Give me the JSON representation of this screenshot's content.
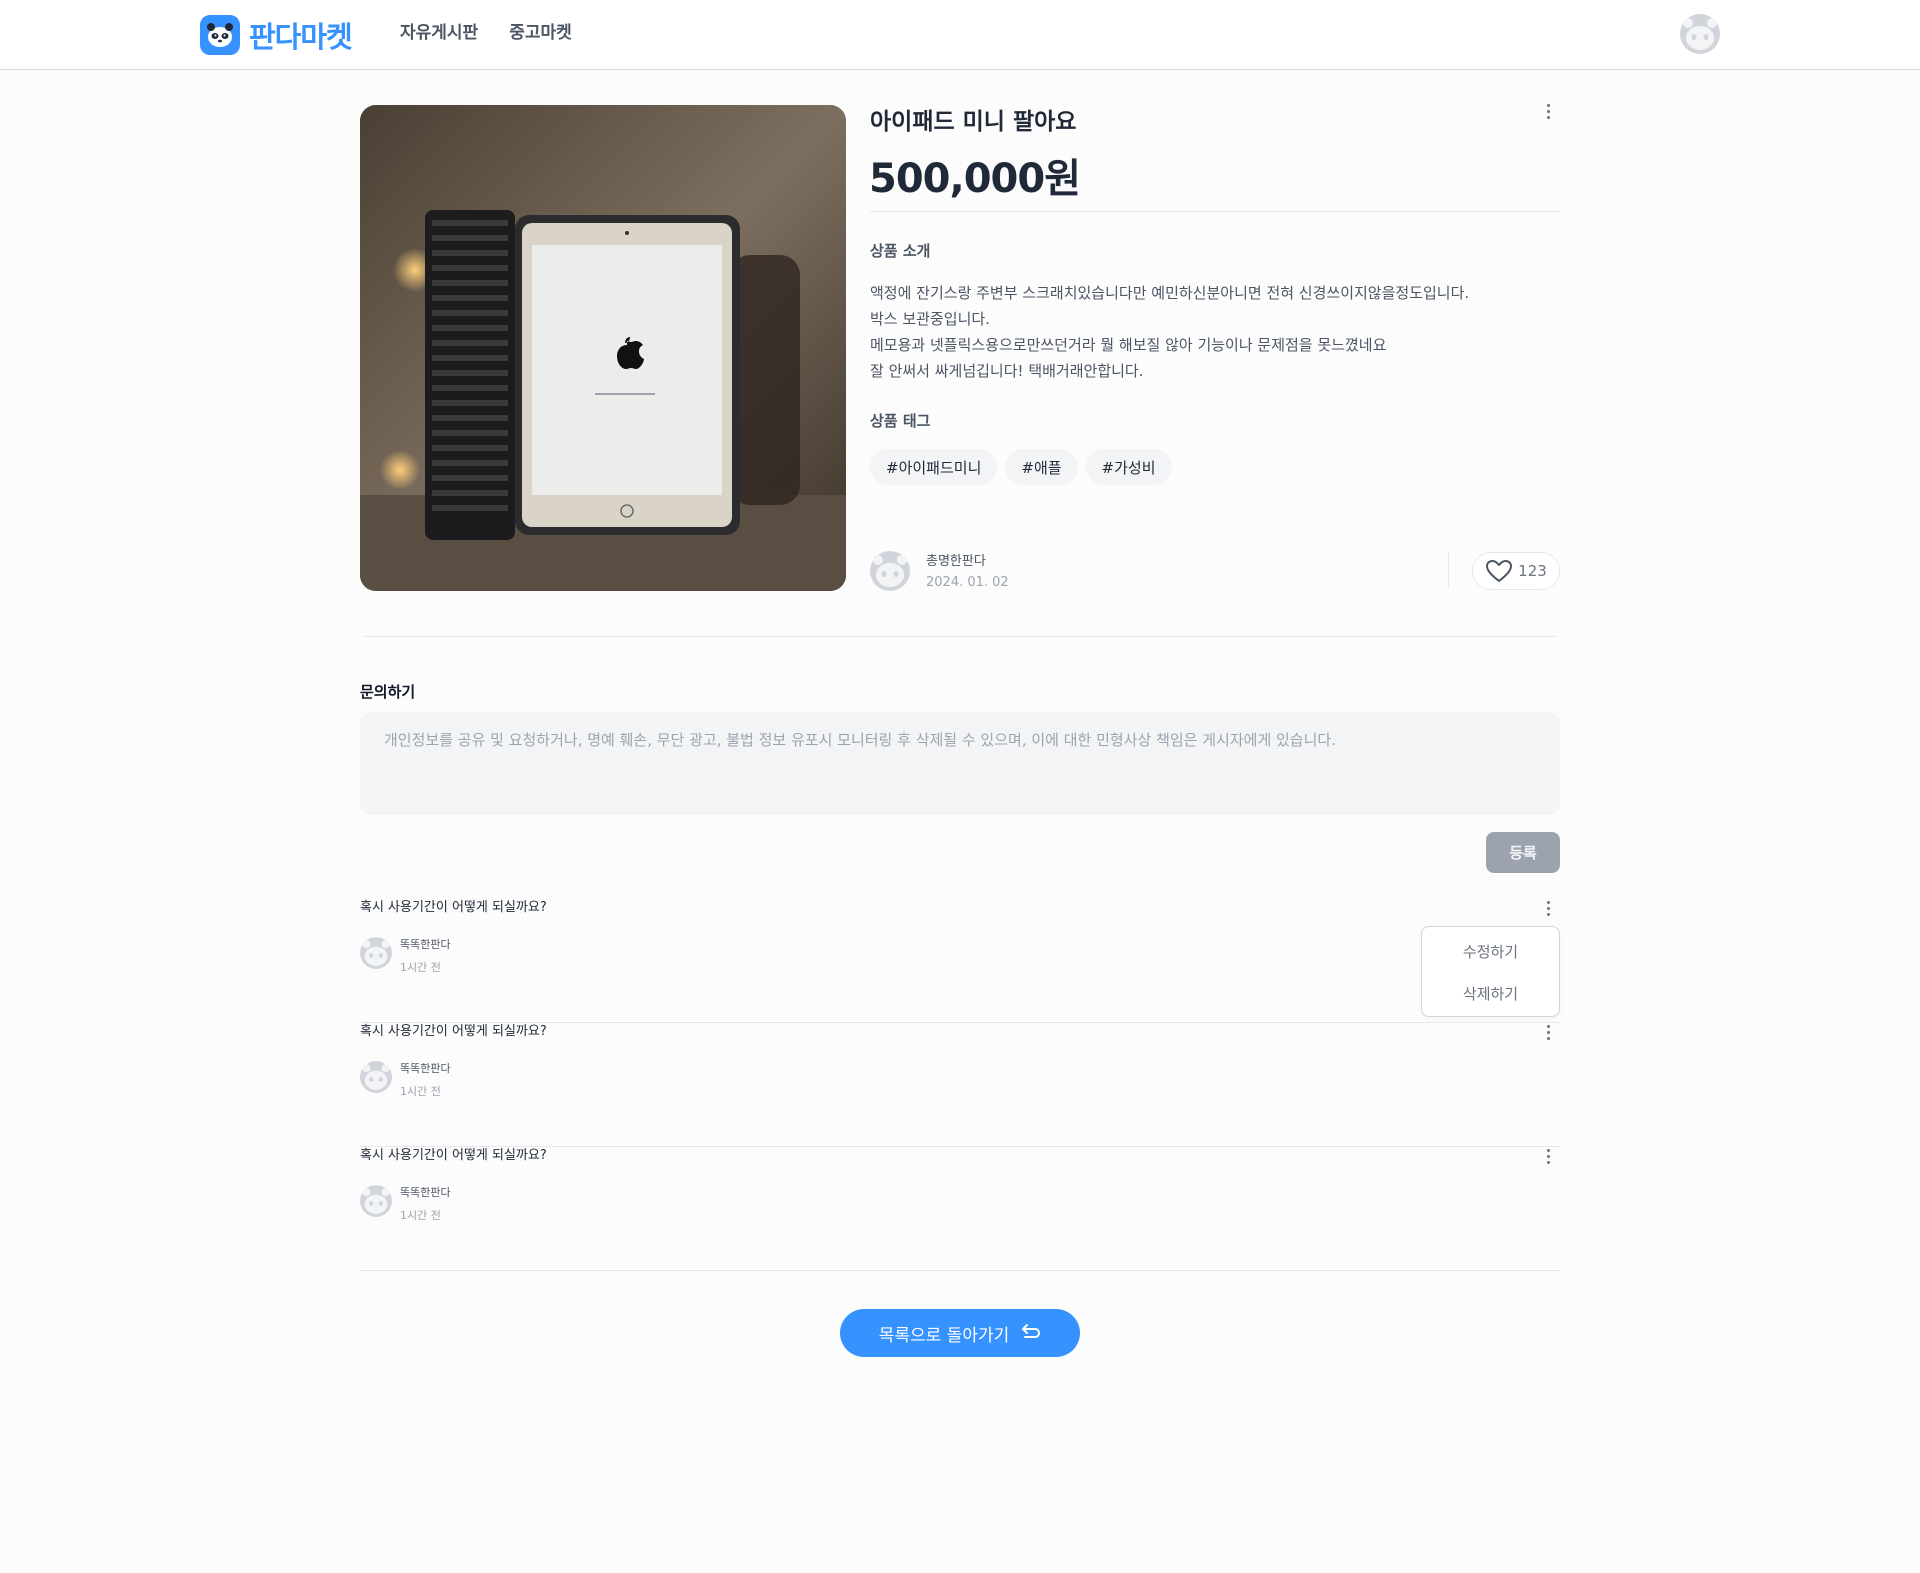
{
  "header": {
    "logo_text": "판다마켓",
    "nav": [
      "자유게시판",
      "중고마켓"
    ],
    "icons": {
      "logo": "panda-logo-icon",
      "profile": "user-avatar-icon"
    },
    "brand_color": "#3692ff"
  },
  "product": {
    "title": "아이패드 미니 팔아요",
    "price": "500,000원",
    "description_label": "상품 소개",
    "description": [
      "액정에 잔기스랑 주변부 스크래치있습니다만 예민하신분아니면 전혀 신경쓰이지않을정도입니다.",
      "박스 보관중입니다.",
      "메모용과 넷플릭스용으로만쓰던거라 뭘 해보질 않아 기능이나 문제점을 못느꼈네요",
      "잘 안써서 싸게넘깁니다! 택배거래안합니다."
    ],
    "tags_label": "상품 태그",
    "tags": [
      "#아이패드미니",
      "#애플",
      "#가성비"
    ],
    "seller": {
      "name": "총명한판다",
      "date": "2024. 01. 02"
    },
    "likes": "123",
    "image_alt": "iPad with keyboard case"
  },
  "inquiry": {
    "title": "문의하기",
    "placeholder": "개인정보를 공유 및 요청하거나, 명예 훼손, 무단 광고, 불법 정보 유포시 모니터링 후 삭제될 수 있으며, 이에 대한 민형사상 책임은 게시자에게 있습니다.",
    "submit_label": "등록"
  },
  "comments": [
    {
      "text": "혹시 사용기간이 어떻게 되실까요?",
      "user": "똑똑한판다",
      "time": "1시간 전"
    },
    {
      "text": "혹시 사용기간이 어떻게 되실까요?",
      "user": "똑똑한판다",
      "time": "1시간 전"
    },
    {
      "text": "혹시 사용기간이 어떻게 되실까요?",
      "user": "똑똑한판다",
      "time": "1시간 전"
    }
  ],
  "dropdown": {
    "edit_label": "수정하기",
    "delete_label": "삭제하기"
  },
  "back_button_label": "목록으로 돌아가기"
}
